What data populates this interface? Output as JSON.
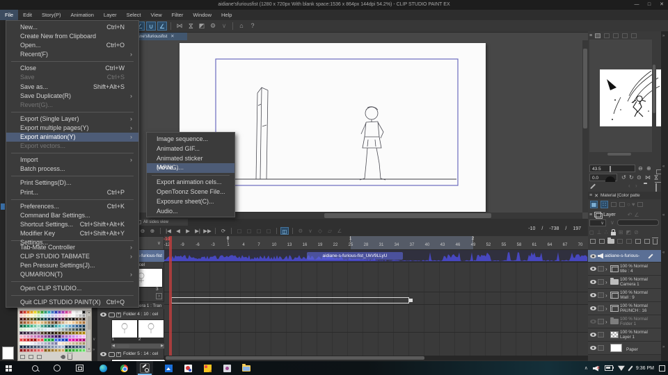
{
  "window": {
    "title": "aidiane'sfuriousfist (1280 x 720px With blank space:1536 x 864px 144dpi 54.2%)  - CLIP STUDIO PAINT EX",
    "controls": {
      "min": "—",
      "max": "□",
      "close": "✕"
    }
  },
  "menu_bar": {
    "items": [
      "File",
      "Edit",
      "Story(P)",
      "Animation",
      "Layer",
      "Select",
      "View",
      "Filter",
      "Window",
      "Help"
    ],
    "active": "File"
  },
  "toolbar_icons": [
    {
      "n": "undo-icon",
      "g": "↶",
      "st": "dim"
    },
    {
      "n": "redo-icon",
      "g": "↷",
      "st": "dim"
    },
    {
      "n": "sep"
    },
    {
      "n": "select-lasso-icon",
      "g": "○",
      "st": "dim"
    },
    {
      "n": "select-marquee-icon",
      "g": "▢",
      "st": "dim"
    },
    {
      "n": "select-polygon-icon",
      "g": "◇",
      "st": "dim"
    },
    {
      "n": "select-shrink-icon",
      "g": "▣",
      "st": "dim"
    },
    {
      "n": "sep"
    },
    {
      "n": "deselect-icon",
      "g": "▧",
      "st": "dim"
    },
    {
      "n": "invert-selection-icon",
      "g": "◪",
      "st": "dim"
    },
    {
      "n": "selection-launcher-icon",
      "g": "◫",
      "st": "dim"
    },
    {
      "n": "sep"
    },
    {
      "n": "grid-icon",
      "g": "▦",
      "st": ""
    },
    {
      "n": "snap-ruler-icon",
      "g": "∠",
      "st": "hl"
    },
    {
      "n": "snap-special-ruler-icon",
      "g": "∪",
      "st": "hl"
    },
    {
      "n": "snap-grid-icon",
      "g": "∠",
      "st": "hl"
    },
    {
      "n": "sep"
    },
    {
      "n": "flip-horizontal-icon",
      "g": "⋈",
      "st": ""
    },
    {
      "n": "hourglass-icon",
      "g": "⋈",
      "st": "rot"
    },
    {
      "n": "rotate-canvas-icon",
      "g": "◩",
      "st": ""
    },
    {
      "n": "gear-dropdown-icon",
      "g": "⚙",
      "st": ""
    },
    {
      "n": "chevron-down-icon",
      "g": "∨",
      "st": "dim"
    },
    {
      "n": "sep"
    },
    {
      "n": "tutorial-icon",
      "g": "⌂",
      "st": ""
    },
    {
      "n": "help-icon",
      "g": "?",
      "st": ""
    }
  ],
  "document_tab": {
    "label": "aidiane'sfuriousfist",
    "close": "✕"
  },
  "file_menu": {
    "items": [
      {
        "label": "New...",
        "shortcut": "Ctrl+N"
      },
      {
        "label": "Create New from Clipboard"
      },
      {
        "label": "Open...",
        "shortcut": "Ctrl+O"
      },
      {
        "label": "Recent(F)",
        "submenu": true
      },
      {
        "sep": true
      },
      {
        "label": "Close",
        "shortcut": "Ctrl+W"
      },
      {
        "label": "Save",
        "shortcut": "Ctrl+S",
        "disabled": true
      },
      {
        "label": "Save as...",
        "shortcut": "Shift+Alt+S"
      },
      {
        "label": "Save Duplicate(R)",
        "submenu": true
      },
      {
        "label": "Revert(G)...",
        "disabled": true
      },
      {
        "sep": true
      },
      {
        "label": "Export (Single Layer)",
        "submenu": true
      },
      {
        "label": "Export multiple pages(Y)",
        "submenu": true
      },
      {
        "label": "Export animation(Y)",
        "submenu": true,
        "highlight": true
      },
      {
        "label": "Export vectors...",
        "disabled": true
      },
      {
        "sep": true
      },
      {
        "label": "Import",
        "submenu": true
      },
      {
        "label": "Batch process..."
      },
      {
        "sep": true
      },
      {
        "label": "Print Settings(D)..."
      },
      {
        "label": "Print...",
        "shortcut": "Ctrl+P"
      },
      {
        "sep": true
      },
      {
        "label": "Preferences...",
        "shortcut": "Ctrl+K"
      },
      {
        "label": "Command Bar Settings..."
      },
      {
        "label": "Shortcut Settings...",
        "shortcut": "Ctrl+Shift+Alt+K"
      },
      {
        "label": "Modifier Key Settings...",
        "shortcut": "Ctrl+Shift+Alt+Y"
      },
      {
        "sep": true
      },
      {
        "label": "Tab-Mate Controller",
        "submenu": true
      },
      {
        "label": "CLIP STUDIO TABMATE",
        "submenu": true
      },
      {
        "label": "Pen Pressure Settings(J)..."
      },
      {
        "label": "QUMARION(T)",
        "submenu": true
      },
      {
        "sep": true
      },
      {
        "label": "Open CLIP STUDIO..."
      },
      {
        "sep": true
      },
      {
        "label": "Quit CLIP STUDIO PAINT(X)",
        "shortcut": "Ctrl+Q"
      }
    ]
  },
  "export_submenu": {
    "items": [
      {
        "label": "Image sequence..."
      },
      {
        "label": "Animated GIF..."
      },
      {
        "label": "Animated sticker (APNG)..."
      },
      {
        "label": "Movie...",
        "highlight": true
      },
      {
        "sep": true
      },
      {
        "label": "Export animation cels..."
      },
      {
        "label": "OpenToonz Scene File..."
      },
      {
        "label": "Exposure sheet(C)..."
      },
      {
        "label": "Audio..."
      }
    ]
  },
  "timeline": {
    "panel_tab": "All sides view",
    "toolbar_icons": [
      {
        "n": "zoom-out-icon",
        "g": "⊖",
        "st": ""
      },
      {
        "n": "zoom-in-icon",
        "g": "⊕",
        "st": ""
      },
      {
        "n": "sep"
      },
      {
        "n": "go-start-icon",
        "g": "|◀",
        "st": ""
      },
      {
        "n": "prev-frame-icon",
        "g": "◀",
        "st": ""
      },
      {
        "n": "play-icon",
        "g": "▶",
        "st": ""
      },
      {
        "n": "next-frame-icon",
        "g": "▶|",
        "st": ""
      },
      {
        "n": "go-end-icon",
        "g": "▶▶",
        "st": ""
      },
      {
        "n": "sep"
      },
      {
        "n": "loop-icon",
        "g": "⟳",
        "st": ""
      },
      {
        "n": "sep"
      },
      {
        "n": "new-cel-icon",
        "g": "▢",
        "st": "dim"
      },
      {
        "n": "new-cel2-icon",
        "g": "▢",
        "st": "dim"
      },
      {
        "n": "cel-settings-icon",
        "g": "▢",
        "st": "dim"
      },
      {
        "n": "cel-batch-icon",
        "g": "▢",
        "st": "dim"
      },
      {
        "n": "sep"
      },
      {
        "n": "onion-skin-icon",
        "g": "◫",
        "st": "hl"
      },
      {
        "n": "sep"
      },
      {
        "n": "light-table-icon",
        "g": "⚙",
        "st": "dim"
      },
      {
        "n": "chevron-down-icon",
        "g": "∨",
        "st": "dim"
      },
      {
        "n": "key-icon",
        "g": "◇",
        "st": "dim"
      },
      {
        "n": "tween-icon",
        "g": "▱",
        "st": "dim"
      },
      {
        "n": "pen-icon",
        "g": "∠",
        "st": "dim"
      }
    ],
    "frame_info": {
      "a": "-10",
      "s1": "/",
      "b": "-738",
      "s2": "/",
      "c": "197"
    },
    "ruler": {
      "numbers": [
        "-12",
        "-9",
        "-6",
        "-3",
        "1",
        "4",
        "7",
        "10",
        "13",
        "16",
        "19",
        "22",
        "25",
        "28",
        "31",
        "34",
        "37",
        "40",
        "43",
        "46",
        "49",
        "52",
        "55",
        "58",
        "61",
        "64",
        "67",
        "70"
      ],
      "seconds": [
        {
          "label": "0",
          "at": "1"
        },
        {
          "label": "1",
          "at": "25"
        },
        {
          "label": "2",
          "at": "49"
        }
      ],
      "selection": {
        "from": "25",
        "to": "49"
      },
      "playhead_label": "-10"
    },
    "audio_clip": "aidiane-s-furious-fist_UkV9LLyU",
    "track_list": {
      "header_chevron": "∨",
      "audio_label": "s-furious-fist",
      "cel_label": ": cel",
      "cel_count": "3",
      "next_btn": "›",
      "camera_label": "era 1 : Tran",
      "folder4_label": "Folder 4 : 10 : cel",
      "folder5_label": "Folder 5 : 14 : cel",
      "cel_num1": "1",
      "cel_num2": "2",
      "scroll_left": "◀",
      "scroll_right": "▶"
    }
  },
  "navigator": {
    "zoom_value": "43.5",
    "rotate_value": "0.0"
  },
  "material_panel": {
    "title": "Material [Color patte"
  },
  "layer_panel": {
    "tab": "Layer",
    "rows": [
      {
        "name": "aidiane-s-furious-",
        "type": "audio",
        "selected": true
      },
      {
        "blend": "100 % Normal",
        "name": "title : 4",
        "type": "celstack",
        "expand": true
      },
      {
        "blend": "100 % Normal",
        "name": "Camera 1",
        "type": "folder",
        "expand": true
      },
      {
        "blend": "100 % Normal",
        "name": "Wall : 9",
        "type": "celstack",
        "expand": true
      },
      {
        "blend": "100 % Normal",
        "name": "PAUNCH : 16",
        "type": "celstack",
        "expand": true
      },
      {
        "blend": "100 % Normal",
        "name": "Folder 1",
        "type": "folder",
        "expand": true,
        "hidden": true
      },
      {
        "blend": "100 % Normal",
        "name": "Layer 1",
        "type": "raster"
      },
      {
        "name": "Paper",
        "type": "paper"
      }
    ]
  },
  "palette_rows": [
    [
      "#9e1b1b",
      "#e03a2f",
      "#f07820",
      "#f6b024",
      "#f7e52a",
      "#a8d33a",
      "#3faa3d",
      "#2fa87c",
      "#35b9c8",
      "#3e78d0",
      "#2b3fc4",
      "#7040c0",
      "#b03cc0",
      "#e040a0",
      "#f080b0",
      "#ffffff",
      "#e8e8e8",
      "#f4f4f4",
      "#141414"
    ],
    [
      "#f6c6c6",
      "#f8d4b8",
      "#fbe6b8",
      "#fdf6c0",
      "#e4f2bc",
      "#c8ecc0",
      "#bceee0",
      "#bce8f0",
      "#c0d8f4",
      "#c4c8f0",
      "#d8c4f0",
      "#ecc4ec",
      "#f6c8e4",
      "#f8d0d4",
      "#fbeaea",
      "#f6f6f6",
      "#dcdcdc",
      "#bcbcbc",
      "#989898"
    ],
    [
      "#3a0d0d",
      "#58180e",
      "#5c3a12",
      "#5a5016",
      "#3c4a14",
      "#1c441c",
      "#124034",
      "#10404a",
      "#123050",
      "#141c48",
      "#2a1248",
      "#44124a",
      "#4c1238",
      "#2c1c14",
      "#262626",
      "#101010",
      "#3c2c1c",
      "#544434",
      "#1c1008"
    ],
    [
      "#7c4a24",
      "#a05c30",
      "#bc763c",
      "#d09050",
      "#e4ac68",
      "#f4c88c",
      "#d8b478",
      "#b89458",
      "#987444",
      "#785430",
      "#583c20",
      "#a88058",
      "#c8a880",
      "#e8d0ac",
      "#f8dcb0",
      "#ecc490",
      "#d8a868",
      "#c08848",
      "#a87038"
    ],
    [
      "#0c5c3c",
      "#108050",
      "#20a06c",
      "#44b488",
      "#70c8a4",
      "#a0dcc4",
      "#48a890",
      "#288878",
      "#1c7068",
      "#145858",
      "#2c9ca0",
      "#58bcc0",
      "#8cd8dc",
      "#78bcd4",
      "#60a0c8",
      "#4880b0",
      "#306090",
      "#1c4870",
      "#103450"
    ],
    [
      "#ccecc8",
      "#d8f0d4",
      "#e4f6e0",
      "#d8f0e4",
      "#c8e8e0",
      "#b4d8d4",
      "#c4e0d8",
      "#d0e4f0",
      "#e0ecf8",
      "#d4e0e8",
      "#c0d0d4",
      "#a8bcc0",
      "#90a4a8",
      "#788c90",
      "#607478",
      "#485c60",
      "#384c50",
      "#283c40",
      "#182c30"
    ],
    [
      "#241430",
      "#34203c",
      "#442c48",
      "#543854",
      "#644460",
      "#74506c",
      "#4c3824",
      "#3c2c1c",
      "#2c2014",
      "#1c140c",
      "#302408",
      "#403008",
      "#503c08",
      "#604808",
      "#705408",
      "#806008",
      "#906c08",
      "#a07808",
      "#b08408"
    ],
    [
      "#f4b4c8",
      "#e8a4c4",
      "#dc94c0",
      "#d084bc",
      "#c474b8",
      "#b864b4",
      "#9c54a4",
      "#844494",
      "#6c3484",
      "#542474",
      "#3c1464",
      "#2c0c54",
      "#9858bc",
      "#a868cc",
      "#b878dc",
      "#c888ec",
      "#d898f4",
      "#e8a8f8",
      "#f4b8fc"
    ],
    [
      "#e83c3c",
      "#d42c2c",
      "#c01c1c",
      "#ac1010",
      "#980808",
      "#f45c5c",
      "#e44c4c",
      "#10b848",
      "#0ca83c",
      "#089830",
      "#3864e8",
      "#2854d8",
      "#1844c8",
      "#0834b8",
      "#e810b0",
      "#d80ca0",
      "#c80890",
      "#b80480",
      "#a80070"
    ],
    [
      "#fbf8e0",
      "#fdfae8",
      "#fffcf0",
      "#ececf4",
      "#dcdce8",
      "#ccccdc",
      "#bcbcd0",
      "#ababc4",
      "#9a9ab8",
      "#8989ac",
      "#7878a0",
      "#f8e8d4",
      "#ecdcc4",
      "#e0d0b4",
      "#d4c4a4",
      "#c8b894",
      "#bcac84",
      "#b0a074",
      "#a49464"
    ],
    [
      "#10203c",
      "#1c2c48",
      "#283854",
      "#344460",
      "#40506c",
      "#4c5c78",
      "#586884",
      "#647490",
      "#70809c",
      "#7c8ca8",
      "#8898b4",
      "#94a4c0",
      "#a0b0cc",
      "#102844",
      "#1c3450",
      "#28405c",
      "#344c68",
      "#405874",
      "#4c6480"
    ],
    [
      "#8c1414",
      "#9c2424",
      "#ac3434",
      "#bc4444",
      "#cc5454",
      "#dc6464",
      "#ec7474",
      "#7c5810",
      "#8c6820",
      "#9c7830",
      "#ac8840",
      "#bc9850",
      "#cca860",
      "#148c14",
      "#249c24",
      "#34ac34",
      "#44bc44",
      "#54cc54",
      "#64dc64"
    ]
  ],
  "taskbar": {
    "time": "9:36 PM"
  },
  "accent_colors": {
    "highlight_blue": "#4d5c77",
    "active_tool_blue": "#2b4a66",
    "playhead_red": "#c43e3e",
    "audio_blue": "#5a6f95",
    "waveform_blue": "#4b4bd6"
  }
}
